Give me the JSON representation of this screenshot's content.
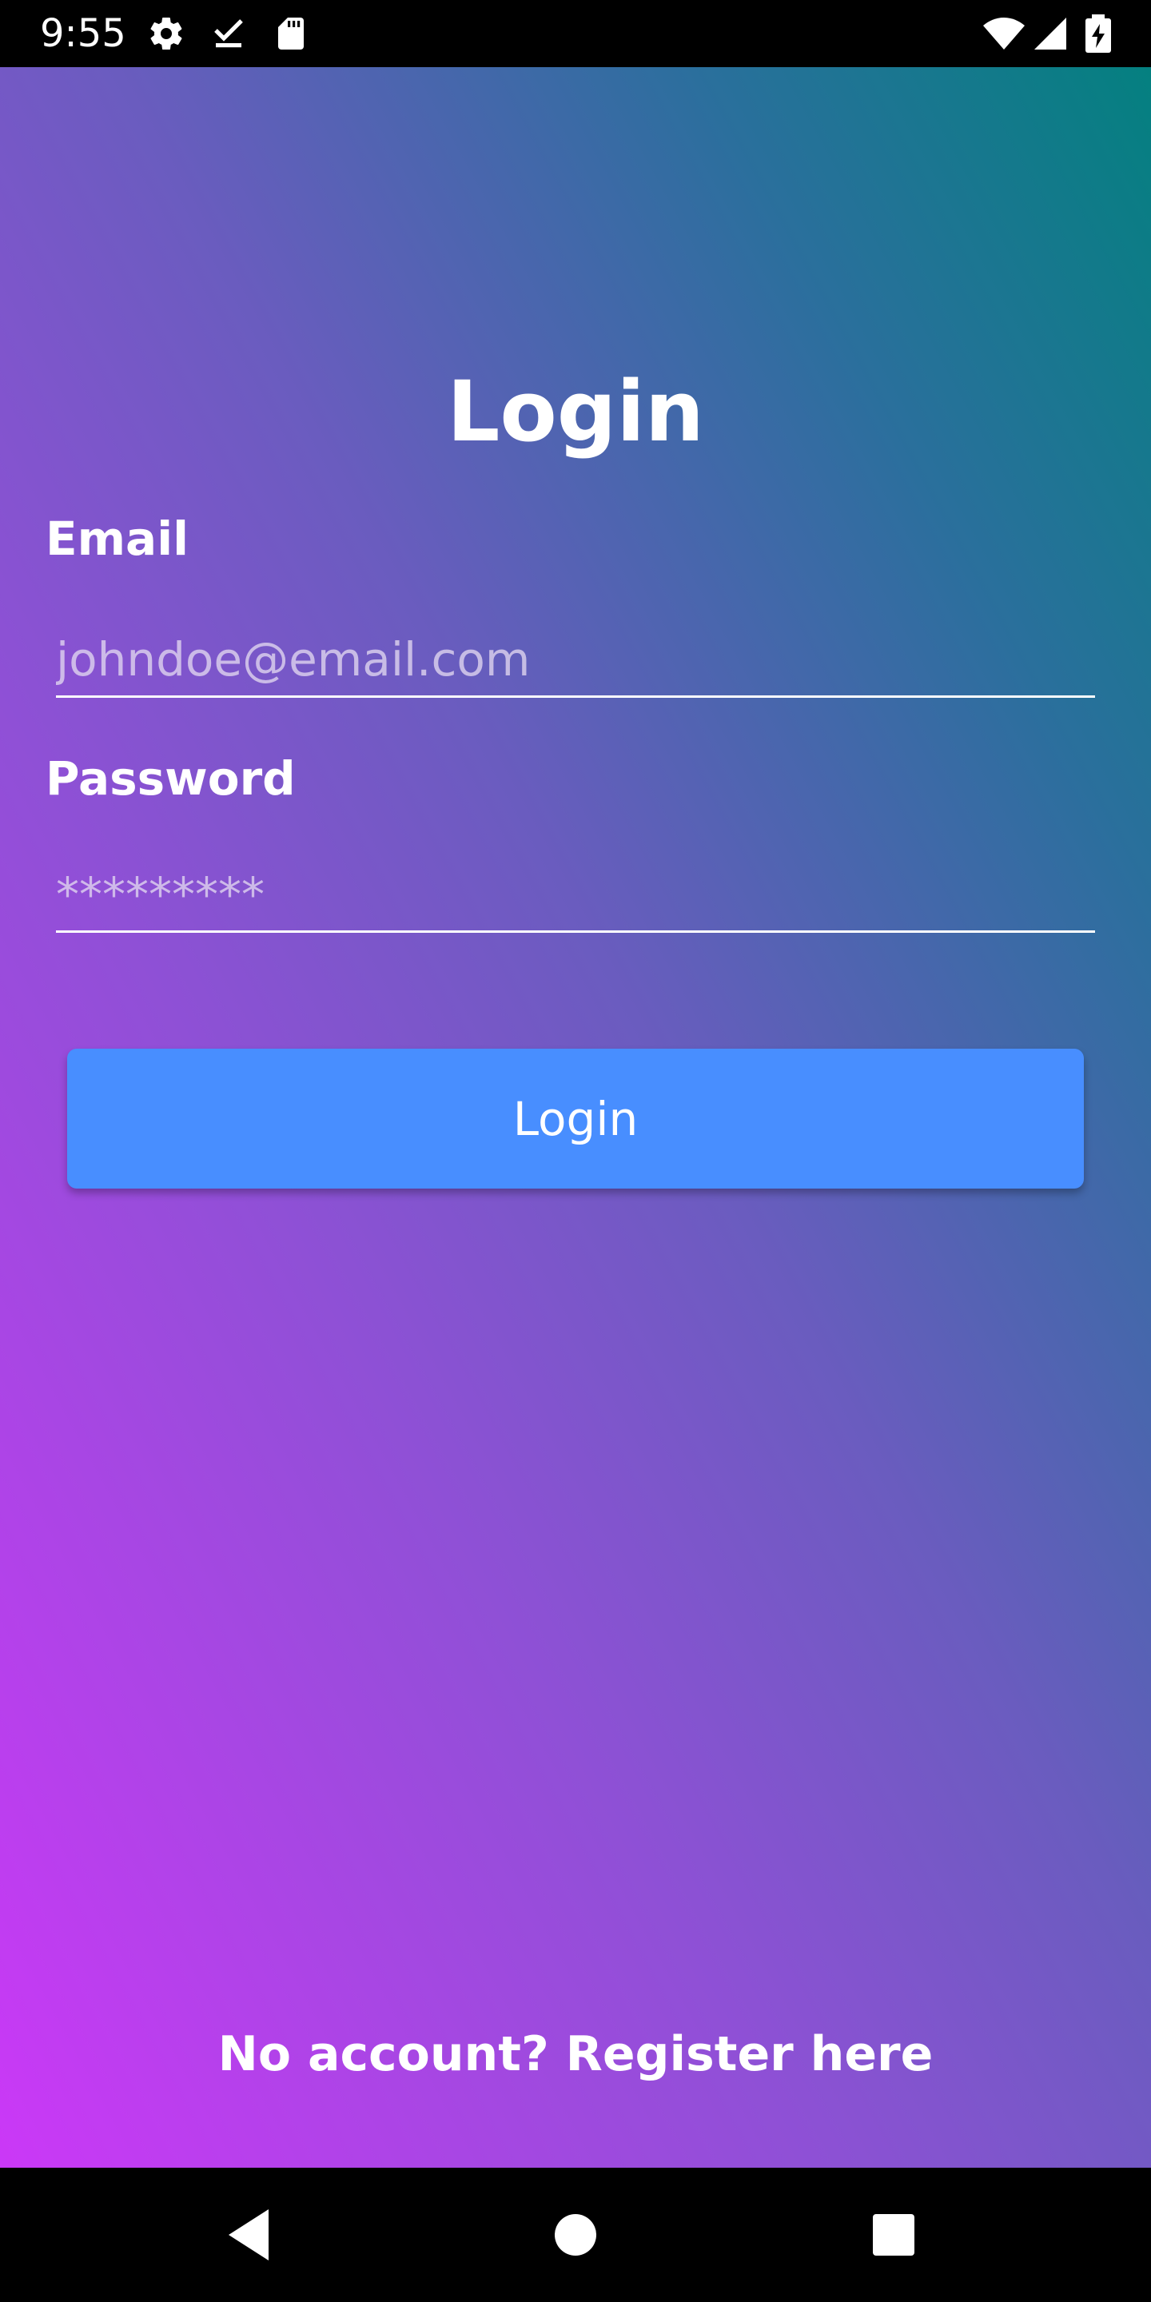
{
  "status_bar": {
    "time": "9:55",
    "left_icons": [
      "gear-icon",
      "download-done-icon",
      "sd-card-icon"
    ],
    "right_icons": [
      "wifi-icon",
      "cell-signal-icon",
      "battery-charging-icon"
    ]
  },
  "login": {
    "title": "Login",
    "email_label": "Email",
    "email_placeholder": "johndoe@email.com",
    "password_label": "Password",
    "password_placeholder": "*********",
    "button_label": "Login",
    "register_text": "No account? Register here"
  },
  "nav_bar": {
    "icons": [
      "back-icon",
      "home-icon",
      "recents-icon"
    ]
  },
  "colors": {
    "gradient_top_right": "#048080",
    "gradient_bottom_left": "#cb38f7",
    "button": "#488eff",
    "text": "#ffffff",
    "system_bars": "#000000"
  }
}
